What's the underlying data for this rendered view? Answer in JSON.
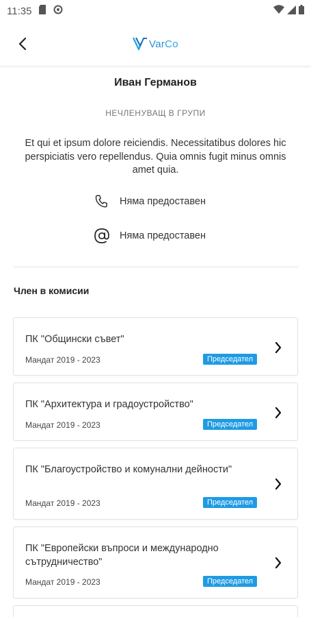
{
  "status_bar": {
    "time": "11:35"
  },
  "app_bar": {
    "logo_text_a": "Var",
    "logo_text_b": "Co"
  },
  "profile": {
    "name": "Иван Германов",
    "membership": "НЕЧЛЕНУВАЩ В ГРУПИ",
    "bio": "Et qui et ipsum dolore reiciendis. Necessitatibus dolores hic perspiciatis vero repellendus. Quia omnis fugit minus omnis amet quia.",
    "phone": "Няма предоставен",
    "email": "Няма предоставен"
  },
  "committees": {
    "section_title": "Член в комисии",
    "items": [
      {
        "title": "ПК \"Общински съвет\"",
        "term": "Мандат 2019 - 2023",
        "role": "Председател"
      },
      {
        "title": "ПК \"Архитектура и градоустройство\"",
        "term": "Мандат 2019 - 2023",
        "role": "Председател"
      },
      {
        "title": "ПК \"Благоустройство и комунални дейности\"",
        "term": "Мандат 2019 - 2023",
        "role": "Председател"
      },
      {
        "title": "ПК \"Европейски въпроси и международно сътрудничество\"",
        "term": "Мандат 2019 - 2023",
        "role": "Председател"
      }
    ]
  },
  "colors": {
    "accent": "#1f9be3",
    "logo": "#2b8fd6"
  }
}
